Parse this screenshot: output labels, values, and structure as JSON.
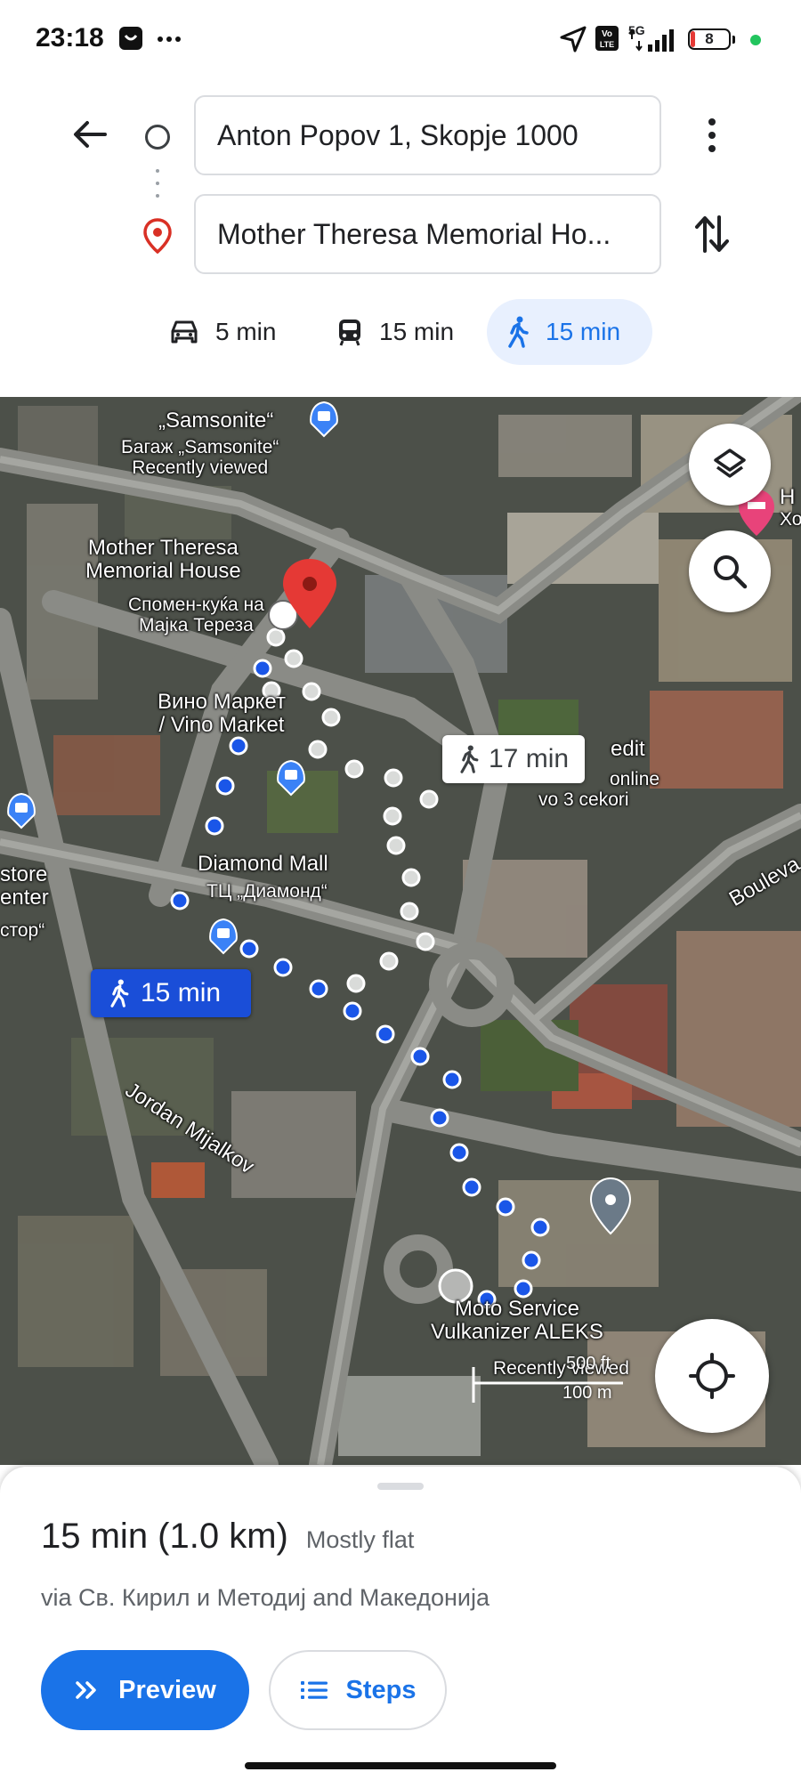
{
  "status_bar": {
    "time": "23:18",
    "network": "5G",
    "battery_level": "8"
  },
  "directions": {
    "origin": "Anton Popov 1, Skopje 1000",
    "destination": "Mother Theresa Memorial Ho...",
    "modes": [
      {
        "icon": "car-icon",
        "label": "5 min",
        "active": false
      },
      {
        "icon": "transit-icon",
        "label": "15 min",
        "active": false
      },
      {
        "icon": "walk-icon",
        "label": "15 min",
        "active": true
      }
    ]
  },
  "map": {
    "labels": {
      "samsonite_1": "„Samsonite“",
      "samsonite_2": "Багаж „Samsonite“",
      "recently_viewed": "Recently viewed",
      "mt_1": "Mother Theresa",
      "mt_2": "Memorial House",
      "mt_3": "Спомен-куќа на",
      "mt_4": "Мајка Тереза",
      "vino_1": "Вино Маркет",
      "vino_2": "/ Vino Market",
      "edit_1": "edit",
      "edit_2": "online",
      "edit_3": "vo 3 cekori",
      "diamond_1": "Diamond Mall",
      "diamond_2": "ТЦ „Диамонд“",
      "store_1": "store",
      "store_2": "enter",
      "store_3": "стор“",
      "boulevard": "Boulevа",
      "jordan": "Jordan Mijalkov",
      "moto_1": "Moto Service",
      "moto_2": "Vulkanizer ALEKS",
      "moto_3": "Recently viewed",
      "hotel_1": "H",
      "hotel_2": "Хо"
    },
    "callout_alt": "17 min",
    "callout_selected": "15 min",
    "scale": {
      "ft": "500 ft",
      "m": "100 m"
    }
  },
  "route": {
    "duration": "15 min (1.0 km)",
    "terrain": "Mostly flat",
    "via": "via Св. Кирил и Методиј and Македонија",
    "preview_label": "Preview",
    "steps_label": "Steps"
  },
  "colors": {
    "accent": "#1a73e8",
    "route_dot": "#1a56e8",
    "pin": "#e53935"
  }
}
